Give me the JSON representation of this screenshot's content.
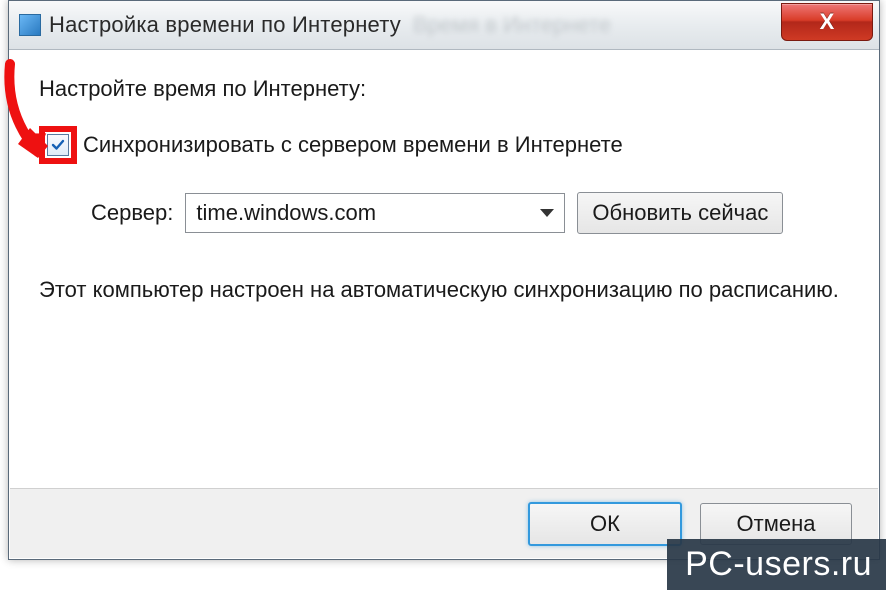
{
  "window": {
    "title": "Настройка времени по Интернету"
  },
  "content": {
    "heading": "Настройте время по Интернету:",
    "sync_checkbox_label": "Синхронизировать с сервером времени в Интернете",
    "sync_checked": true,
    "server_label": "Сервер:",
    "server_value": "time.windows.com",
    "update_button": "Обновить сейчас",
    "status_text": "Этот компьютер настроен на автоматическую синхронизацию по расписанию."
  },
  "buttons": {
    "ok": "ОК",
    "cancel": "Отмена"
  },
  "watermark": "PC-users.ru"
}
